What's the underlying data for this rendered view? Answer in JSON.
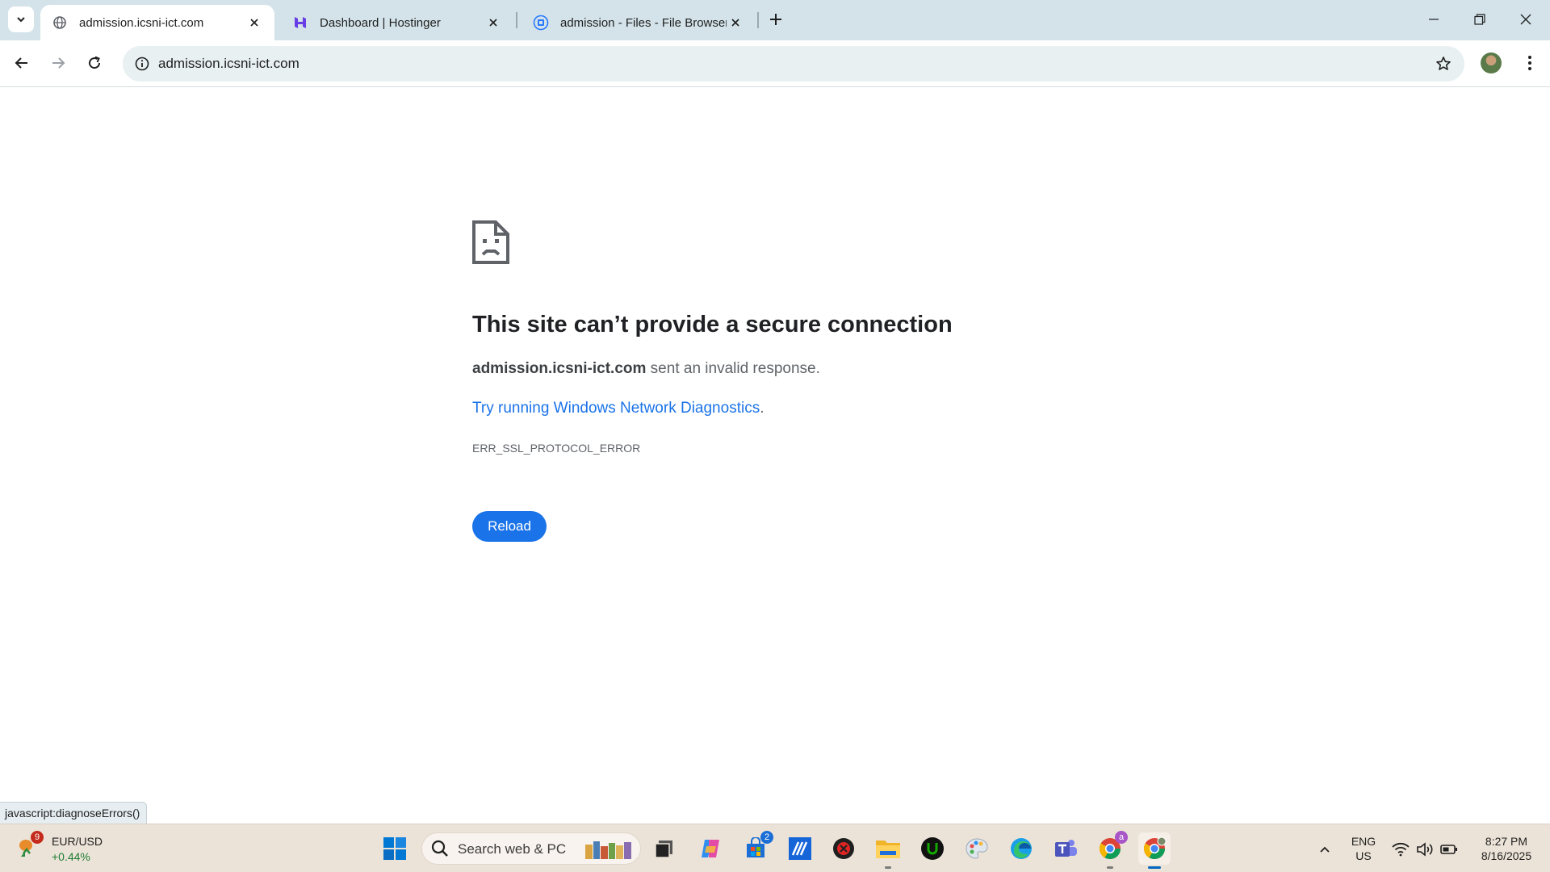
{
  "browser": {
    "tabs": [
      {
        "title": "admission.icsni-ict.com",
        "active": true,
        "favicon": "globe-icon"
      },
      {
        "title": "Dashboard | Hostinger",
        "active": false,
        "favicon": "hostinger-icon"
      },
      {
        "title": "admission - Files - File Browser",
        "active": false,
        "favicon": "file-browser-icon"
      }
    ],
    "address_bar": {
      "url": "admission.icsni-ict.com"
    },
    "colors": {
      "tabstrip": "#d3e3e9",
      "omnibox": "#e8f0f2"
    }
  },
  "error_page": {
    "title": "This site can’t provide a secure connection",
    "description_host": "admission.icsni-ict.com",
    "description_rest": " sent an invalid response.",
    "link_text": "Try running Windows Network Diagnostics",
    "link_period": ".",
    "error_code": "ERR_SSL_PROTOCOL_ERROR",
    "reload_label": "Reload",
    "colors": {
      "accent": "#1a73e8",
      "title": "#202124",
      "text": "#5f6368"
    }
  },
  "status_bar": {
    "text": "javascript:diagnoseErrors()"
  },
  "taskbar": {
    "widget": {
      "badge": "9",
      "name": "EUR/USD",
      "change": "+0.44%"
    },
    "search_placeholder": "Search web & PC",
    "store_badge": "2",
    "chrome_profile_badge": "a",
    "language": {
      "line1": "ENG",
      "line2": "US"
    },
    "clock": {
      "time": "8:27 PM",
      "date": "8/16/2025"
    }
  }
}
